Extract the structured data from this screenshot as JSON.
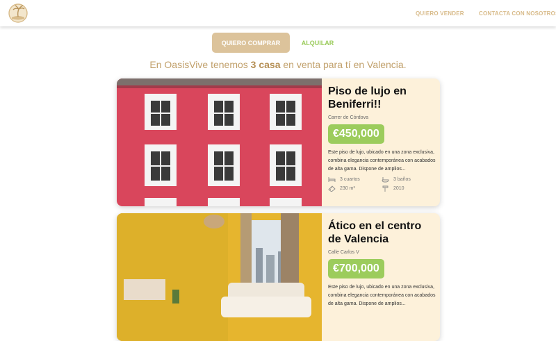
{
  "nav": {
    "logo": "OasisVive",
    "sell_label": "QUIERO VENDER",
    "contact_label": "CONTACTA CON NOSOTROS"
  },
  "tabs": {
    "buy_label": "QUIERO COMPRAR",
    "rent_label": "ALQUILAR"
  },
  "summary": {
    "prefix": "En OasisVive tenemos ",
    "count": "3 casa",
    "suffix": " en venta para tí en Valencia."
  },
  "listings": [
    {
      "title": "Piso de lujo en Beniferri!!",
      "address": "Carrer de Córdova",
      "price": "€450,000",
      "description": "Este piso de lujo, ubicado en una zona exclusiva, combina elegancia contemporánea con acabados de alta gama. Dispone de amplios...",
      "rooms": "3 cuartos",
      "baths": "3 baños",
      "area": "230 m²",
      "year": "2010"
    },
    {
      "title": "Ático en el centro de Valencia",
      "address": "Calle Carlos V",
      "price": "€700,000",
      "description": "Este piso de lujo, ubicado en una zona exclusiva, combina elegancia contemporánea con acabados de alta gama. Dispone de amplios..."
    }
  ],
  "colors": {
    "accent_tan": "#dcc39b",
    "accent_green": "#9ccc5c",
    "card_bg": "#fdf1da"
  }
}
